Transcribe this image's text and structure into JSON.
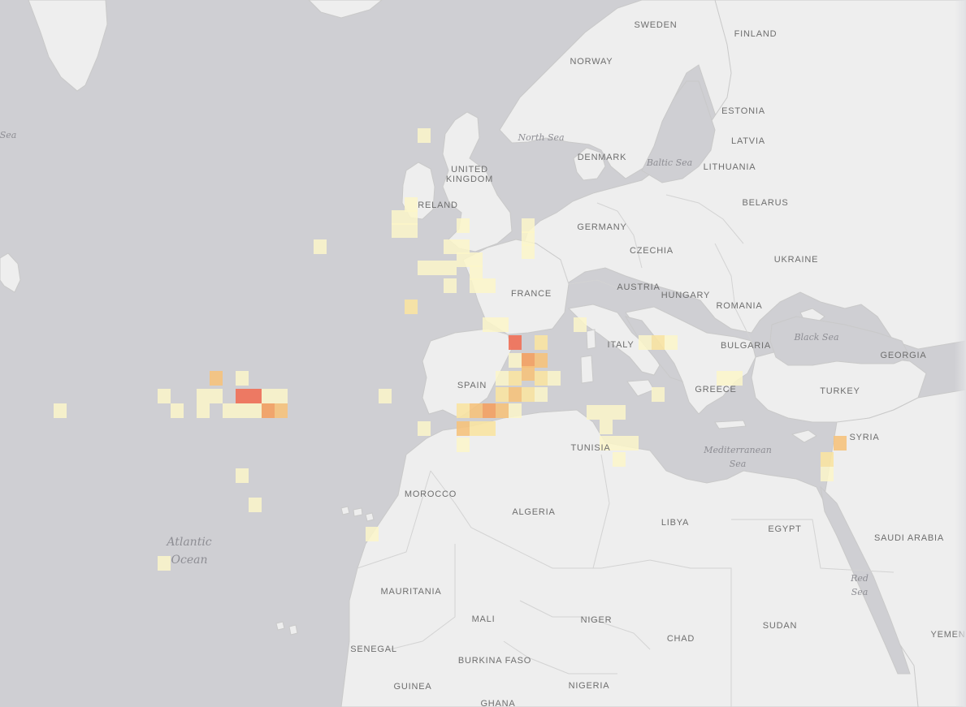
{
  "map": {
    "colors": {
      "water": "#cfcfd3",
      "land": "#eeeeee",
      "border": "#c9c9c9",
      "heat_low": "#fbf6c9",
      "heat_mid_low": "#f8e3a2",
      "heat_mid": "#f5c27c",
      "heat_high": "#f3a062",
      "heat_max": "#ef6f57"
    },
    "country_labels": [
      {
        "text": "SWEDEN"
      },
      {
        "text": "FINLAND"
      },
      {
        "text": "NORWAY"
      },
      {
        "text": "ESTONIA"
      },
      {
        "text": "LATVIA"
      },
      {
        "text": "DENMARK"
      },
      {
        "text": "LITHUANIA"
      },
      {
        "text": "UNITED"
      },
      {
        "text": "KINGDOM"
      },
      {
        "text": "RELAND"
      },
      {
        "text": "GERMANY"
      },
      {
        "text": "BELARUS"
      },
      {
        "text": "CZECHIA"
      },
      {
        "text": "UKRAINE"
      },
      {
        "text": "FRANCE"
      },
      {
        "text": "AUSTRIA"
      },
      {
        "text": "HUNGARY"
      },
      {
        "text": "ROMANIA"
      },
      {
        "text": "ITALY"
      },
      {
        "text": "BULGARIA"
      },
      {
        "text": "GEORGIA"
      },
      {
        "text": "SPAIN"
      },
      {
        "text": "GREECE"
      },
      {
        "text": "TURKEY"
      },
      {
        "text": "SYRIA"
      },
      {
        "text": "TUNISIA"
      },
      {
        "text": "MOROCCO"
      },
      {
        "text": "ALGERIA"
      },
      {
        "text": "LIBYA"
      },
      {
        "text": "EGYPT"
      },
      {
        "text": "SAUDI ARABIA"
      },
      {
        "text": "MAURITANIA"
      },
      {
        "text": "MALI"
      },
      {
        "text": "NIGER"
      },
      {
        "text": "CHAD"
      },
      {
        "text": "SUDAN"
      },
      {
        "text": "YEMEN"
      },
      {
        "text": "SENEGAL"
      },
      {
        "text": "BURKINA FASO"
      },
      {
        "text": "GUINEA"
      },
      {
        "text": "NIGERIA"
      },
      {
        "text": "GHANA"
      }
    ],
    "sea_labels": [
      {
        "text": "Sea"
      },
      {
        "text": "North Sea"
      },
      {
        "text": "Baltic Sea"
      },
      {
        "text": "Black Sea"
      },
      {
        "text": "Mediterranean"
      },
      {
        "text": "Sea"
      },
      {
        "text": "Red"
      },
      {
        "text": "Sea"
      }
    ],
    "ocean_labels": [
      {
        "text": "Atlantic"
      },
      {
        "text": "Ocean"
      }
    ],
    "heat_levels": [
      "low",
      "mid_low",
      "mid",
      "high",
      "max"
    ]
  }
}
